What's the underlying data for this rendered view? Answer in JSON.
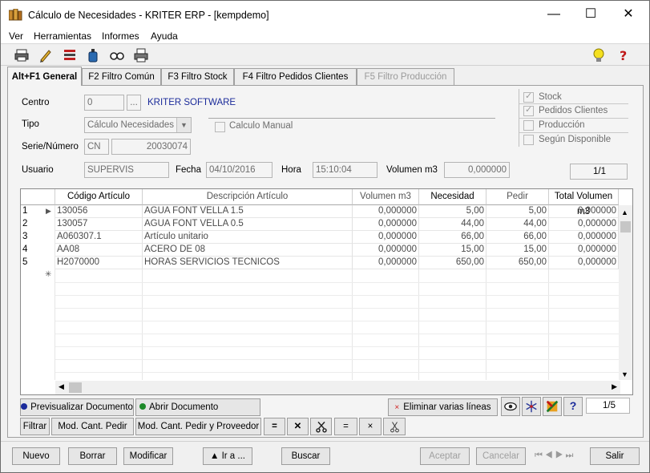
{
  "window": {
    "title": "Cálculo de Necesidades - KRITER ERP - [kempdemo]",
    "minimize": "—",
    "maximize": "☐",
    "close": "✕"
  },
  "menu": [
    "Ver",
    "Herramientas",
    "Informes",
    "Ayuda"
  ],
  "toolbar": {
    "icons": [
      "print-icon",
      "pencil-icon",
      "list-icon",
      "bottle-icon",
      "glasses-icon",
      "printer-preview-icon"
    ],
    "right_icons": [
      "lightbulb-icon",
      "help-icon"
    ]
  },
  "tabs": [
    {
      "label": "Alt+F1 General",
      "active": true
    },
    {
      "label": "F2 Filtro Común"
    },
    {
      "label": "F3 Filtro Stock"
    },
    {
      "label": "F4 Filtro Pedidos Clientes"
    },
    {
      "label": "F5 Filtro Producción",
      "disabled": true
    }
  ],
  "form": {
    "centro_label": "Centro",
    "centro_value": "0",
    "centro_lookup": "...",
    "centro_name": "KRITER SOFTWARE",
    "tipo_label": "Tipo",
    "tipo_value": "Cálculo Necesidades",
    "calculo_manual": "Calculo Manual",
    "serie_label": "Serie/Número",
    "serie_value": "CN",
    "numero_value": "20030074",
    "usuario_label": "Usuario",
    "usuario_value": "SUPERVIS",
    "fecha_label": "Fecha",
    "fecha_value": "04/10/2016",
    "hora_label": "Hora",
    "hora_value": "15:10:04",
    "volumen_label": "Volumen m3",
    "volumen_value": "0,000000",
    "pager": "1/1"
  },
  "options": [
    {
      "label": "Stock",
      "checked": true
    },
    {
      "label": "Pedidos Clientes",
      "checked": true
    },
    {
      "label": "Producción",
      "checked": false
    },
    {
      "label": "Según Disponible",
      "checked": false
    }
  ],
  "grid": {
    "columns": [
      "Código Artículo",
      "Descripción Artículo",
      "Volumen m3",
      "Necesidad",
      "Pedir",
      "Total Volumen m3"
    ],
    "rows": [
      {
        "n": "1",
        "code": "130056",
        "desc": "AGUA FONT VELLA 1.5",
        "vol": "0,000000",
        "nec": "5,00",
        "pedir": "5,00",
        "total": "0,000000"
      },
      {
        "n": "2",
        "code": "130057",
        "desc": "AGUA FONT VELLA 0.5",
        "vol": "0,000000",
        "nec": "44,00",
        "pedir": "44,00",
        "total": "0,000000"
      },
      {
        "n": "3",
        "code": "A060307.1",
        "desc": "Artículo unitario",
        "vol": "0,000000",
        "nec": "66,00",
        "pedir": "66,00",
        "total": "0,000000"
      },
      {
        "n": "4",
        "code": "AA08",
        "desc": "ACERO DE 08",
        "vol": "0,000000",
        "nec": "15,00",
        "pedir": "15,00",
        "total": "0,000000"
      },
      {
        "n": "5",
        "code": "H2070000",
        "desc": "HORAS SERVICIOS TECNICOS",
        "vol": "0,000000",
        "nec": "650,00",
        "pedir": "650,00",
        "total": "0,000000"
      }
    ]
  },
  "actions": {
    "preview": "Previsualizar Documento",
    "open": "Abrir Documento",
    "delete_lines": "Eliminar varias líneas",
    "pager": "1/5",
    "filtrar": "Filtrar",
    "mod_cant": "Mod. Cant. Pedir",
    "mod_cant_prov": "Mod. Cant. Pedir y Proveedor",
    "eq1": "=",
    "x1": "✕",
    "eq2": "=",
    "x2": "×"
  },
  "bottom": {
    "nuevo": "Nuevo",
    "borrar": "Borrar",
    "modificar": "Modificar",
    "ira": "▲ Ir a ...",
    "buscar": "Buscar",
    "aceptar": "Aceptar",
    "cancelar": "Cancelar",
    "salir": "Salir"
  }
}
